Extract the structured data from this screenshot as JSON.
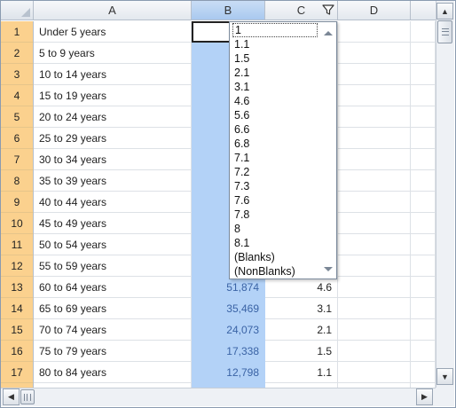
{
  "columns": [
    "A",
    "B",
    "C",
    "D"
  ],
  "rows": [
    {
      "num": "1",
      "a": "Under 5 years",
      "b": "",
      "c": ""
    },
    {
      "num": "2",
      "a": "5 to 9 years",
      "b": "",
      "c": ""
    },
    {
      "num": "3",
      "a": "10 to 14 years",
      "b": "",
      "c": ""
    },
    {
      "num": "4",
      "a": "15 to 19 years",
      "b": "",
      "c": ""
    },
    {
      "num": "5",
      "a": "20 to 24 years",
      "b": "",
      "c": ""
    },
    {
      "num": "6",
      "a": "25 to 29 years",
      "b": "",
      "c": ""
    },
    {
      "num": "7",
      "a": "30 to 34 years",
      "b": "",
      "c": ""
    },
    {
      "num": "8",
      "a": "35 to 39 years",
      "b": "",
      "c": ""
    },
    {
      "num": "9",
      "a": "40 to 44 years",
      "b": "",
      "c": ""
    },
    {
      "num": "10",
      "a": "45 to 49 years",
      "b": "",
      "c": ""
    },
    {
      "num": "11",
      "a": "50 to 54 years",
      "b": "",
      "c": ""
    },
    {
      "num": "12",
      "a": "55 to 59 years",
      "b": "",
      "c": ""
    },
    {
      "num": "13",
      "a": "60 to 64 years",
      "b": "51,874",
      "c": "4.6"
    },
    {
      "num": "14",
      "a": "65 to 69 years",
      "b": "35,469",
      "c": "3.1"
    },
    {
      "num": "15",
      "a": "70 to 74 years",
      "b": "24,073",
      "c": "2.1"
    },
    {
      "num": "16",
      "a": "75 to 79 years",
      "b": "17,338",
      "c": "1.5"
    },
    {
      "num": "17",
      "a": "80 to 84 years",
      "b": "12,798",
      "c": "1.1"
    }
  ],
  "filter_dropdown": {
    "items": [
      "1",
      "1.1",
      "1.5",
      "2.1",
      "3.1",
      "4.6",
      "5.6",
      "6.6",
      "6.8",
      "7.1",
      "7.2",
      "7.3",
      "7.6",
      "7.8",
      "8",
      "8.1",
      "(Blanks)",
      "(NonBlanks)"
    ]
  },
  "icons": {
    "filter": "filter-funnel-icon",
    "scroll_up": "up-arrow-icon",
    "scroll_down": "down-arrow-icon",
    "scroll_left": "left-arrow-icon",
    "scroll_right": "right-arrow-icon"
  },
  "colors": {
    "row_header": "#fbd18e",
    "selected_column": "#b3d2f7",
    "selected_text": "#3a63a5"
  }
}
